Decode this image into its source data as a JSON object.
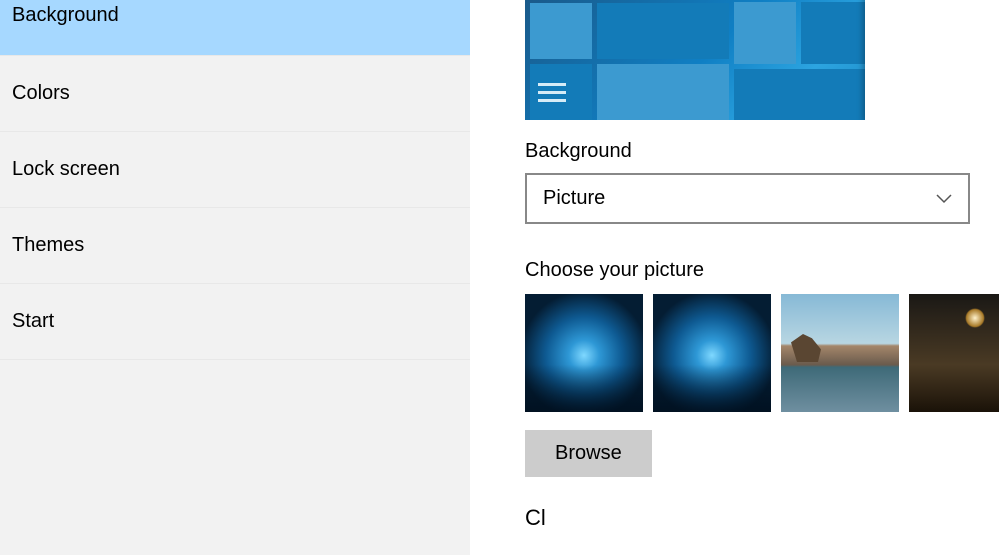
{
  "sidebar": {
    "items": [
      {
        "label": "Background",
        "selected": true
      },
      {
        "label": "Colors",
        "selected": false
      },
      {
        "label": "Lock screen",
        "selected": false
      },
      {
        "label": "Themes",
        "selected": false
      },
      {
        "label": "Start",
        "selected": false
      }
    ]
  },
  "main": {
    "background_label": "Background",
    "background_value": "Picture",
    "choose_label": "Choose your picture",
    "browse_label": "Browse",
    "partial_label": "Cl"
  }
}
